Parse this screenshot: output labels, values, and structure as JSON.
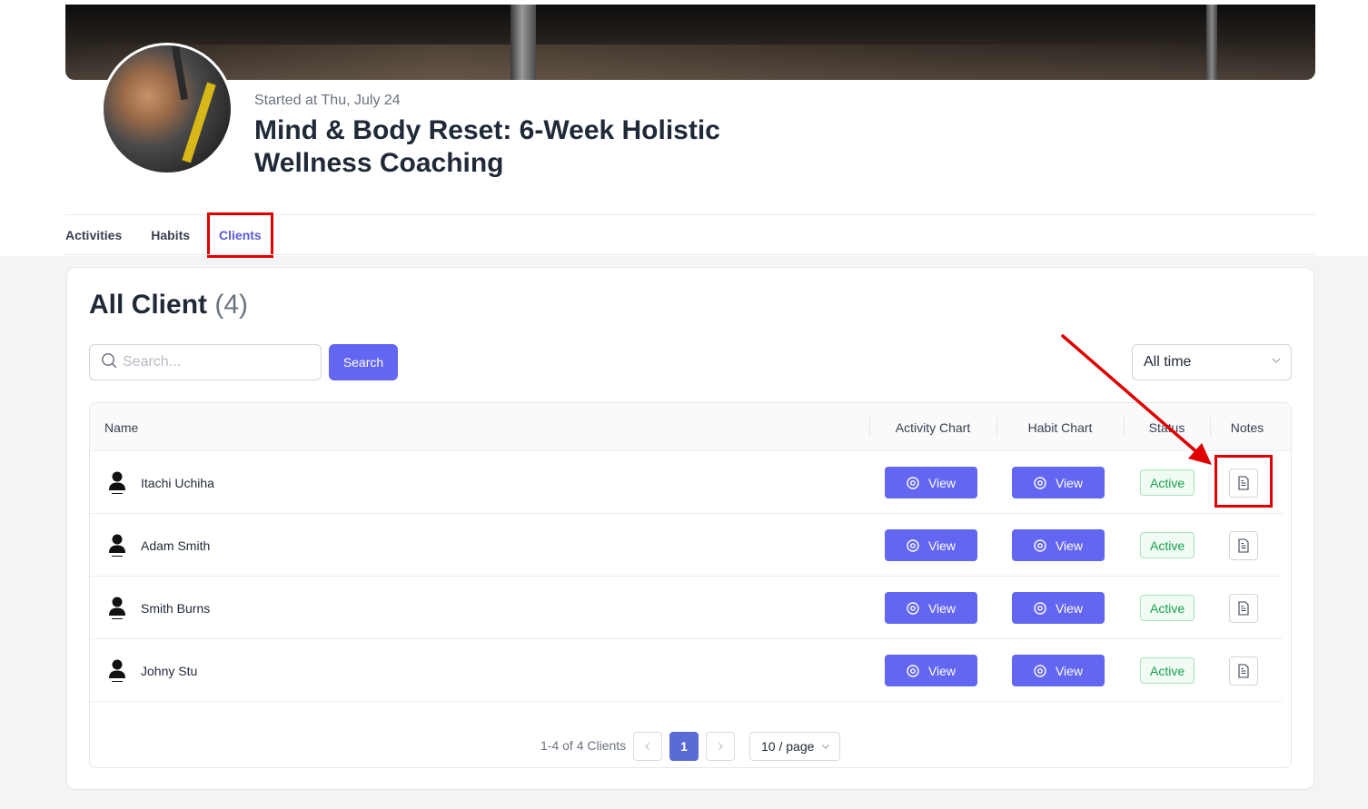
{
  "program": {
    "started": "Started at Thu, July 24",
    "title": "Mind & Body Reset: 6-Week Holistic Wellness Coaching"
  },
  "tabs": [
    {
      "label": "Activities"
    },
    {
      "label": "Habits"
    },
    {
      "label": "Clients",
      "active": true
    }
  ],
  "clients_section": {
    "title": "All Client",
    "count": "(4)",
    "search_placeholder": "Search...",
    "search_button": "Search",
    "time_filter": "All time"
  },
  "table": {
    "headers": {
      "name": "Name",
      "activity_chart": "Activity Chart",
      "habit_chart": "Habit Chart",
      "status": "Status",
      "notes": "Notes"
    },
    "rows": [
      {
        "name": "Itachi Uchiha",
        "activity_label": "View",
        "habit_label": "View",
        "status": "Active"
      },
      {
        "name": "Adam Smith",
        "activity_label": "View",
        "habit_label": "View",
        "status": "Active"
      },
      {
        "name": "Smith Burns",
        "activity_label": "View",
        "habit_label": "View",
        "status": "Active"
      },
      {
        "name": "Johny Stu",
        "activity_label": "View",
        "habit_label": "View",
        "status": "Active"
      }
    ]
  },
  "pagination": {
    "summary": "1-4 of 4 Clients",
    "current_page": "1",
    "page_size": "10 / page"
  },
  "colors": {
    "accent": "#6366f1",
    "active_tab": "#5b5bd6",
    "status_green": "#16a34a",
    "annotation_red": "#e00000"
  }
}
